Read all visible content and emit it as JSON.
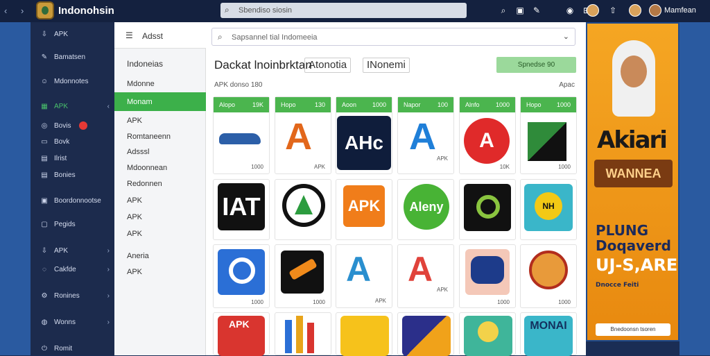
{
  "topbar": {
    "nav_arrows": "‹ ›",
    "brand": "Indonohsin",
    "search_placeholder": "Sbendiso siosin",
    "user_name": "Mamfean"
  },
  "leftnav": {
    "items": [
      {
        "label": "APK",
        "icon": "download-icon"
      },
      {
        "label": "Bamatsen",
        "icon": "edit-icon"
      },
      {
        "label": "Mdonnotes",
        "icon": "user-icon"
      },
      {
        "label": "APK",
        "icon": "grid-icon",
        "active": true
      },
      {
        "label": "Bovis",
        "icon": "circle-icon",
        "badge": true
      },
      {
        "label": "Bovk",
        "icon": "folder-icon"
      },
      {
        "label": "Ilrist",
        "icon": "file-icon"
      },
      {
        "label": "Bonies",
        "icon": "list-icon"
      },
      {
        "label": "Boordonnootse",
        "icon": "calendar-icon"
      },
      {
        "label": "Pegids",
        "icon": "doc-icon"
      },
      {
        "label": "APK",
        "icon": "download-icon",
        "chevron": true
      },
      {
        "label": "Cakfde",
        "icon": "circle-icon",
        "chevron": true
      },
      {
        "label": "Ronines",
        "icon": "settings-icon",
        "chevron": true
      },
      {
        "label": "Wonns",
        "icon": "circle-icon",
        "chevron": true
      },
      {
        "label": "Romit",
        "icon": "power-icon"
      }
    ]
  },
  "subnav": {
    "title": "Adsst",
    "items": [
      "Indoneias",
      "Mdonne",
      "Monam",
      "APK",
      "Romtaneenn",
      "Adsssl",
      "Mdoonnean",
      "Redonnen",
      "APK",
      "APK",
      "APK",
      "Aneria",
      "APK"
    ]
  },
  "main": {
    "search_placeholder": "Sapsannel tial Indomeeia",
    "title": "Dackat lnoinbrktan",
    "chip1": "Atonotia",
    "chip2": "INonemi",
    "green_button": "Spnedse 90",
    "sub_left": "APK  donso 180",
    "sub_right": "Apac",
    "cards": [
      {
        "h1": "Alopo",
        "h2": "19K",
        "label": "1000"
      },
      {
        "h1": "Hopo",
        "h2": "130",
        "label": "APK"
      },
      {
        "h1": "Aoon",
        "h2": "1000",
        "label": "AHc"
      },
      {
        "h1": "Napor",
        "h2": "100",
        "label": "APK"
      },
      {
        "h1": "Alnfo",
        "h2": "1000",
        "label": "10K"
      },
      {
        "h1": "Hopo",
        "h2": "1000",
        "label": "1000"
      },
      {
        "h1": "",
        "h2": "",
        "label": "APK"
      },
      {
        "h1": "",
        "h2": "",
        "label": ""
      },
      {
        "h1": "",
        "h2": "",
        "label": "APK"
      },
      {
        "h1": "",
        "h2": "",
        "label": "Alvny"
      },
      {
        "h1": "",
        "h2": "",
        "label": ""
      },
      {
        "h1": "",
        "h2": "",
        "label": "NH"
      },
      {
        "h1": "",
        "h2": "",
        "label": "1000"
      },
      {
        "h1": "",
        "h2": "",
        "label": "1000"
      },
      {
        "h1": "",
        "h2": "",
        "label": "APK"
      },
      {
        "h1": "",
        "h2": "",
        "label": "APK"
      },
      {
        "h1": "",
        "h2": "",
        "label": "1000"
      },
      {
        "h1": "",
        "h2": "",
        "label": "1000"
      }
    ],
    "tile_texts": [
      "AHc",
      "APK",
      "Aleny",
      "IAT",
      "MONAI"
    ]
  },
  "ad": {
    "title": "Akiari",
    "banner": "WANNEA",
    "line1": "PLUNG",
    "line2": "Doqaverd",
    "line3": "UJ-S,ARE",
    "line4": "Dnocce Feiti",
    "footer": "Bnedoonsn tsoren"
  },
  "colors": {
    "green": "#4bb54e",
    "navy": "#1c2b4d",
    "orange": "#f5a623"
  }
}
